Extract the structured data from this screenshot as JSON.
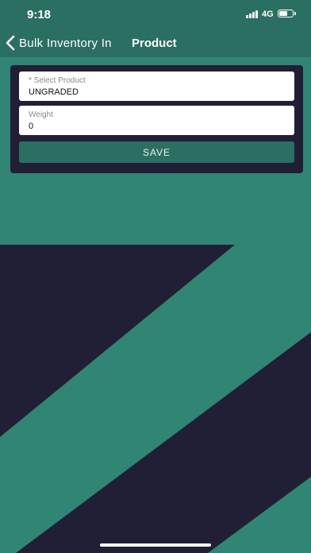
{
  "status_bar": {
    "time": "9:18",
    "network": "4G",
    "icons": [
      "signal-icon",
      "battery-icon"
    ]
  },
  "nav": {
    "back_label": "Bulk Inventory In",
    "title": "Product",
    "icons": [
      "chevron-left-icon"
    ]
  },
  "form": {
    "product_field": {
      "label": "* Select Product",
      "value": "UNGRADED"
    },
    "weight_field": {
      "label": "Weight",
      "value": "0"
    },
    "save_label": "SAVE"
  },
  "colors": {
    "background": "#318575",
    "header": "#2b6f62",
    "dark_navy": "#211f35",
    "button": "#2b6f62"
  }
}
